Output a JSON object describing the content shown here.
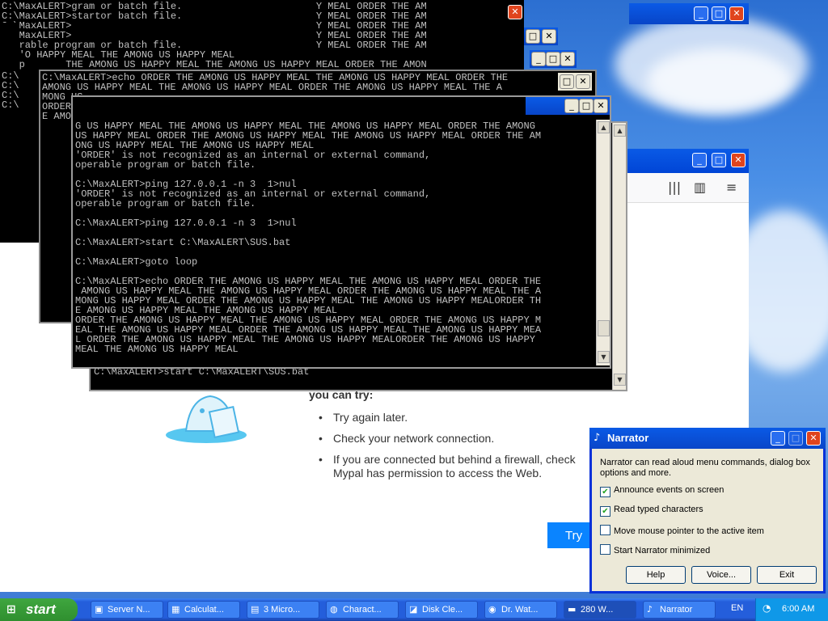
{
  "console_main": {
    "lines": [
      "G US HAPPY MEAL THE AMONG US HAPPY MEAL THE AMONG US HAPPY MEAL ORDER THE AMONG",
      "US HAPPY MEAL ORDER THE AMONG US HAPPY MEAL THE AMONG US HAPPY MEAL ORDER THE AM",
      "ONG US HAPPY MEAL THE AMONG US HAPPY MEAL",
      "'ORDER' is not recognized as an internal or external command,",
      "operable program or batch file.",
      "",
      "C:\\MaxALERT>ping 127.0.0.1 -n 3  1>nul",
      "'ORDER' is not recognized as an internal or external command,",
      "operable program or batch file.",
      "",
      "C:\\MaxALERT>ping 127.0.0.1 -n 3  1>nul",
      "",
      "C:\\MaxALERT>start C:\\MaxALERT\\SUS.bat",
      "",
      "C:\\MaxALERT>goto loop",
      "",
      "C:\\MaxALERT>echo ORDER THE AMONG US HAPPY MEAL THE AMONG US HAPPY MEAL ORDER THE",
      " AMONG US HAPPY MEAL THE AMONG US HAPPY MEAL ORDER THE AMONG US HAPPY MEAL THE A",
      "MONG US HAPPY MEAL ORDER THE AMONG US HAPPY MEAL THE AMONG US HAPPY MEALORDER TH",
      "E AMONG US HAPPY MEAL THE AMONG US HAPPY MEAL",
      "ORDER THE AMONG US HAPPY MEAL THE AMONG US HAPPY MEAL ORDER THE AMONG US HAPPY M",
      "EAL THE AMONG US HAPPY MEAL ORDER THE AMONG US HAPPY MEAL THE AMONG US HAPPY MEA",
      "L ORDER THE AMONG US HAPPY MEAL THE AMONG US HAPPY MEALORDER THE AMONG US HAPPY",
      "MEAL THE AMONG US HAPPY MEAL"
    ]
  },
  "console_back": {
    "lines": [
      "C:\\MaxALERT>gram or batch file.                       Y MEAL ORDER THE AM",
      "C:\\MaxALERT>startor batch file.                       Y MEAL ORDER THE AM",
      "C:\\MaxALERT>                                          Y MEAL ORDER THE AM",
      "C:\\MaxALERT>                                          Y MEAL ORDER THE AM",
      "operable program or batch file.                       Y MEAL ORDER THE AM",
      "ONG'O HAPPY MEAL THE AMONG US HAPPY MEAL",
      "  op       THE AMONG US HAPPY MEAL THE AMONG US HAPPY MEAL ORDER THE AMON"
    ]
  },
  "console_layer": {
    "lines": [
      "C:\\MaxALERT>echo ORDER THE AMONG US HAPPY MEAL THE AMONG US HAPPY MEAL ORDER THE",
      "AMONG US HAPPY MEAL THE AMONG US HAPPY MEAL ORDER THE AMONG US HAPPY MEAL THE A",
      "MONG US",
      "ORDER                   MEAL THE AMONG US HAPPY MEAL ORDER THE AMON",
      "E AMONG                 il>ernal or external command,MEAL ORDER THE AMON"
    ]
  },
  "console_bottom": {
    "line": "C:\\MaxALERT>start C:\\MaxALERT\\SUS.bat"
  },
  "browser": {
    "heading": "you can try:",
    "items": [
      "Try again later.",
      "Check your network connection.",
      "If you are connected but behind a firewall, check",
      "Mypal has permission to access the Web."
    ],
    "try_button": "Try"
  },
  "narrator": {
    "title": "Narrator",
    "description": "Narrator can read aloud menu commands, dialog box options and more.",
    "options": [
      {
        "label": "Announce events on screen",
        "checked": true
      },
      {
        "label": "Read typed characters",
        "checked": true
      },
      {
        "label": "Move mouse pointer to the active item",
        "checked": false
      },
      {
        "label": "Start Narrator minimized",
        "checked": false
      }
    ],
    "buttons": {
      "help": "Help",
      "voice": "Voice...",
      "exit": "Exit"
    }
  },
  "taskbar": {
    "start": "start",
    "tasks": [
      {
        "label": "Server N..."
      },
      {
        "label": "Calculat..."
      },
      {
        "label": "3 Micro..."
      },
      {
        "label": "Charact..."
      },
      {
        "label": "Disk Cle..."
      },
      {
        "label": "Dr. Wat..."
      },
      {
        "label": "280 W..."
      },
      {
        "label": "Narrator"
      }
    ],
    "lang": "EN",
    "time": "6:00 AM"
  },
  "colors": {
    "title_blue": "#0a5ae6",
    "close_red": "#e0441d",
    "start_green": "#3fa63f",
    "firefox_blue": "#0a84ff"
  }
}
